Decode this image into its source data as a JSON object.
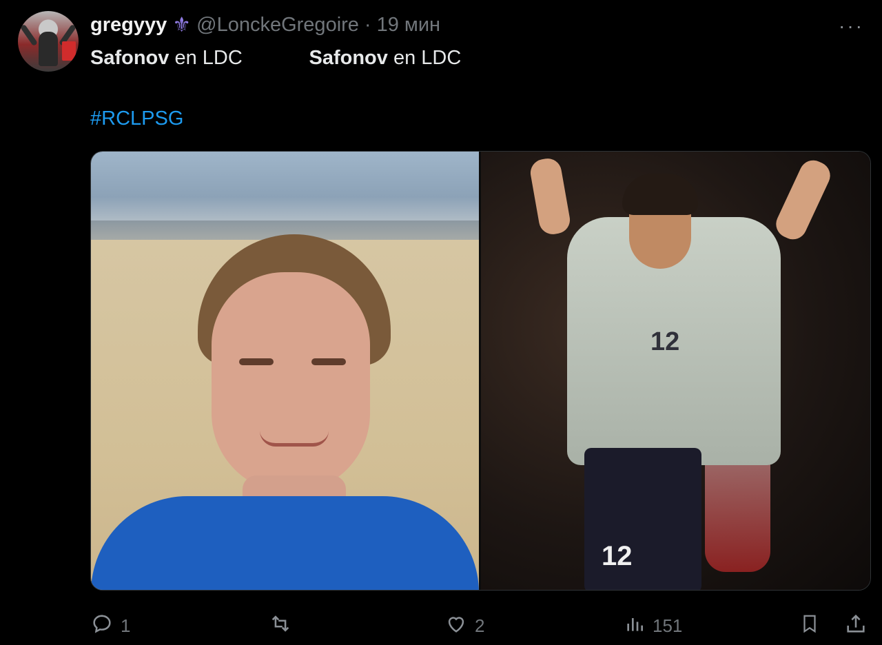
{
  "tweet": {
    "name": "gregyyy",
    "name_emoji": "⚜",
    "handle": "@LonckeGregoire",
    "separator": "·",
    "time": "19 мин",
    "text_segments": {
      "left_bold": "Safonov",
      "left_rest": " en LDC",
      "right_bold": "Safonov",
      "right_rest": " en LDC"
    },
    "hashtag": "#RCLPSG",
    "more_label": "···"
  },
  "media": {
    "left_image": {
      "shirt_number": ""
    },
    "right_image": {
      "jersey_number": "12",
      "shorts_number": "12"
    }
  },
  "actions": {
    "reply_count": "1",
    "retweet_count": "",
    "like_count": "2",
    "views_count": "151"
  },
  "colors": {
    "background": "#000000",
    "text": "#e7e9ea",
    "muted": "#71767b",
    "link": "#1d9bf0"
  }
}
